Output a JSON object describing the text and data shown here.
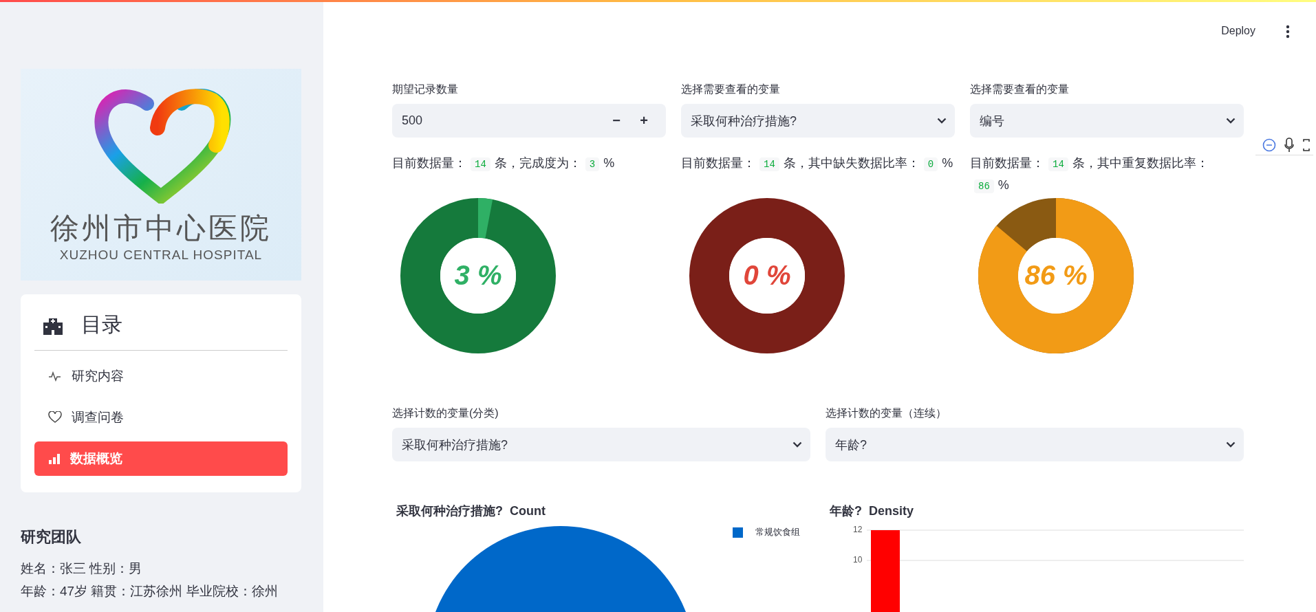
{
  "header": {
    "deploy": "Deploy"
  },
  "sidebar": {
    "logo": {
      "name": "徐州市中心医院",
      "subtitle": "XUZHOU CENTRAL HOSPITAL"
    },
    "menu": {
      "title": "目录",
      "items": [
        {
          "label": "研究内容",
          "selected": false
        },
        {
          "label": "调查问卷",
          "selected": false
        },
        {
          "label": "数据概览",
          "selected": true
        }
      ]
    },
    "team": {
      "title": "研究团队",
      "lines": [
        "姓名：张三 性别：男",
        "年龄：47岁 籍贯：江苏徐州 毕业院校：徐州"
      ]
    }
  },
  "controls": [
    {
      "kind": "number",
      "label": "期望记录数量",
      "value": "500",
      "minus": "−",
      "plus": "+"
    },
    {
      "kind": "select",
      "label": "选择需要查看的变量",
      "value": "采取何种治疗措施?"
    },
    {
      "kind": "select",
      "label": "选择需要查看的变量",
      "value": "编号"
    }
  ],
  "stats": [
    {
      "prefix": "目前数据量：",
      "count": "14",
      "middle": "条，完成度为：",
      "value": "3",
      "suffix": "%"
    },
    {
      "prefix": "目前数据量：",
      "count": "14",
      "middle": "条，其中缺失数据比率：",
      "value": "0",
      "suffix": "%"
    },
    {
      "prefix": "目前数据量：",
      "count": "14",
      "middle": "条，其中重复数据比率：",
      "value": "86",
      "suffix": "%"
    }
  ],
  "donuts": [
    {
      "label": "3 %",
      "level": 0.03
    },
    {
      "label": "0 %",
      "level": 0
    },
    {
      "label": "86 %",
      "level": 0.86
    }
  ],
  "count_selects": [
    {
      "label": "选择计数的变量(分类)",
      "value": "采取何种治疗措施?"
    },
    {
      "label": "选择计数的变量（连续）",
      "value": "年龄?"
    }
  ],
  "charts": [
    {
      "kind": "pie",
      "title": "采取何种治疗措施?  Count",
      "legend": [
        "常规饮食组"
      ]
    },
    {
      "kind": "histogram",
      "title": "年龄?  Density",
      "y_tick_labels": [
        "12",
        "10"
      ]
    }
  ]
}
